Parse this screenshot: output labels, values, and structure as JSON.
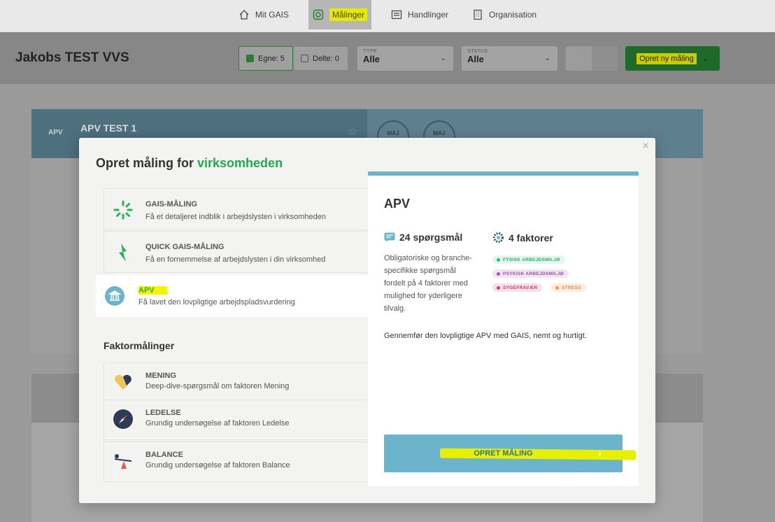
{
  "nav": {
    "items": [
      {
        "label": "Mit GAIS",
        "icon": "home-icon"
      },
      {
        "label": "Målinger",
        "icon": "target-icon"
      },
      {
        "label": "Handlinger",
        "icon": "list-icon"
      },
      {
        "label": "Organisation",
        "icon": "building-icon"
      }
    ]
  },
  "header": {
    "company": "Jakobs TEST VVS",
    "filters": {
      "own": "Egne: 5",
      "shared": "Delte: 0"
    },
    "type": {
      "caption": "TYPE",
      "value": "Alle"
    },
    "status": {
      "caption": "STATUS",
      "value": "Alle"
    },
    "create_label": "Opret ny måling"
  },
  "card": {
    "tag": "APV",
    "name": "APV TEST 1",
    "dates": [
      "MAJ",
      "MAJ"
    ]
  },
  "modal": {
    "title_prefix": "Opret måling for ",
    "title_accent": "virksomheden",
    "options": [
      {
        "title": "GAIS-MÅLING",
        "desc": "Få et detaljeret indblik i arbejdslysten i virksomheden"
      },
      {
        "title": "QUICK GAIS-MÅLING",
        "desc": "Få en fornemmelse af arbejdslysten i din virksomhed"
      },
      {
        "title": "APV",
        "desc": "Få lavet den lovpligtige arbejdspladsvurdering"
      }
    ],
    "section_title": "Faktormålinger",
    "factors": [
      {
        "title": "MENING",
        "desc": "Deep-dive-spørgsmål om faktoren Mening"
      },
      {
        "title": "LEDELSE",
        "desc": "Grundig undersøgelse af faktoren Ledelse"
      },
      {
        "title": "BALANCE",
        "desc": "Grundig undersøgelse af faktoren Balance"
      }
    ],
    "panel": {
      "title": "APV",
      "questions": "24 spørgsmål",
      "factors_count": "4 faktorer",
      "description": "Obligatoriske og branche-specifikke spørgsmål fordelt på 4 faktorer med mulighed for yderligere tilvalg.",
      "pills": [
        "FYSISK ARBEJDSMILJØ",
        "PSYKISK ARBEJDSMILJØ",
        "SYGEFRAVÆR",
        "STRESS"
      ],
      "note": "Gennemfør den lovpligtige APV med GAIS, nemt og hurtigt.",
      "cta": "OPRET MÅLING"
    }
  },
  "colors": {
    "accent_green": "#1fa84e",
    "panel_blue": "#6cb4cc",
    "highlight": "#f1f500"
  }
}
